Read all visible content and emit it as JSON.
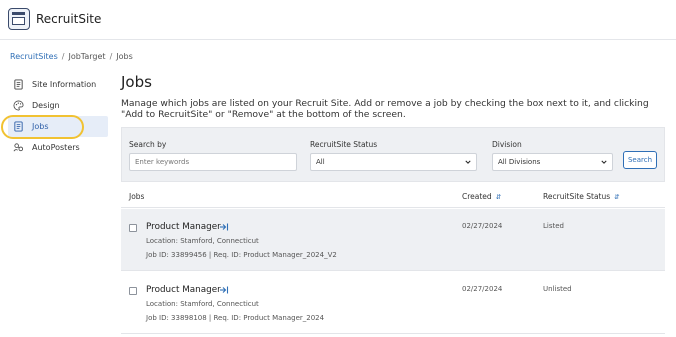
{
  "app": {
    "title": "RecruitSite"
  },
  "breadcrumb": {
    "items": [
      "RecruitSites",
      "JobTarget",
      "Jobs"
    ],
    "separator": "/"
  },
  "sidebar": {
    "items": [
      {
        "label": "Site Information",
        "icon": "document-icon"
      },
      {
        "label": "Design",
        "icon": "palette-icon"
      },
      {
        "label": "Jobs",
        "icon": "jobs-document-icon",
        "active": true
      },
      {
        "label": "AutoPosters",
        "icon": "autoposter-icon"
      }
    ]
  },
  "page": {
    "title": "Jobs",
    "description": "Manage which jobs are listed on your Recruit Site. Add or remove a job by checking the box next to it, and clicking \"Add to RecruitSite\" or \"Remove\" at the bottom of the screen."
  },
  "filters": {
    "search_label": "Search by",
    "search_placeholder": "Enter keywords",
    "status_label": "RecruitSite Status",
    "status_value": "All",
    "division_label": "Division",
    "division_value": "All Divisions",
    "search_button": "Search"
  },
  "table": {
    "headers": {
      "jobs": "Jobs",
      "created": "Created",
      "status": "RecruitSite Status"
    },
    "rows": [
      {
        "title": "Product Manager",
        "location_line": "Location:  Stamford, Connecticut",
        "id_line": "Job ID: 33899456  | Req. ID: Product Manager_2024_V2",
        "created": "02/27/2024",
        "status": "Listed"
      },
      {
        "title": "Product Manager",
        "location_line": "Location:  Stamford, Connecticut",
        "id_line": "Job ID: 33898108  | Req. ID: Product Manager_2024",
        "created": "02/27/2024",
        "status": "Unlisted"
      }
    ]
  },
  "colors": {
    "accent": "#2f6fb6",
    "highlight": "#f1c232",
    "panel_bg": "#eef0f3"
  }
}
